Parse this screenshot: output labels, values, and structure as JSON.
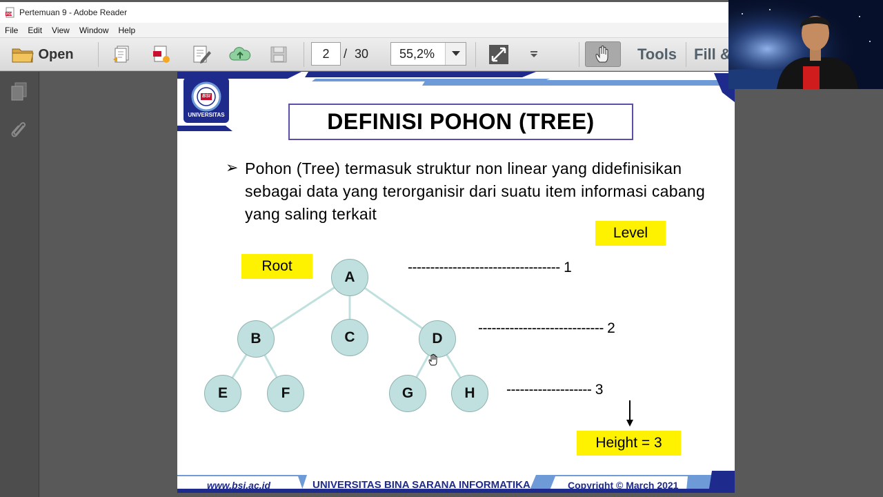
{
  "window": {
    "title": "Pertemuan 9 - Adobe Reader"
  },
  "menu": {
    "items": [
      "File",
      "Edit",
      "View",
      "Window",
      "Help"
    ]
  },
  "toolbar": {
    "open_label": "Open",
    "page_current": "2",
    "page_total": "/ 30",
    "zoom": "55,2%",
    "tools_label": "Tools",
    "fill_label": "Fill &"
  },
  "icons": {
    "pdf": "pdf-file-icon",
    "open": "folder-icon",
    "create": "create-pdf-icon",
    "export": "export-pdf-icon",
    "edit": "edit-pdf-icon",
    "upload": "cloud-upload-icon",
    "save": "save-icon",
    "fit": "fit-page-icon",
    "more": "dropdown-arrow-icon",
    "hand": "hand-tool-icon",
    "pages": "pages-panel-icon",
    "attach": "attachment-icon"
  },
  "colors": {
    "slide_blue": "#1e2a8c",
    "node_fill": "#bfe0de",
    "highlight": "#fff200",
    "title_border": "#5a4fa6"
  },
  "slide": {
    "logo_bottom": "UNIVERSITAS",
    "logo_ring_text": "BINA SARANA INFORMATIKA",
    "logo_monogram": "BSI",
    "title": "DEFINISI POHON (TREE)",
    "bullet": "➢",
    "text": "Pohon (Tree) termasuk struktur non linear yang didefinisikan sebagai data yang terorganisir dari suatu item informasi cabang yang saling terkait",
    "root_label": "Root",
    "level_label": "Level",
    "height_label": "Height = 3",
    "levels": [
      "---------------------------------- 1",
      "---------------------------- 2",
      "------------------- 3"
    ],
    "nodes": {
      "A": "A",
      "B": "B",
      "C": "C",
      "D": "D",
      "E": "E",
      "F": "F",
      "G": "G",
      "H": "H"
    },
    "footer": {
      "website": "www.bsi.ac.id",
      "university": "UNIVERSITAS BINA SARANA INFORMATIKA",
      "copyright": "Copyright © March 2021"
    }
  }
}
